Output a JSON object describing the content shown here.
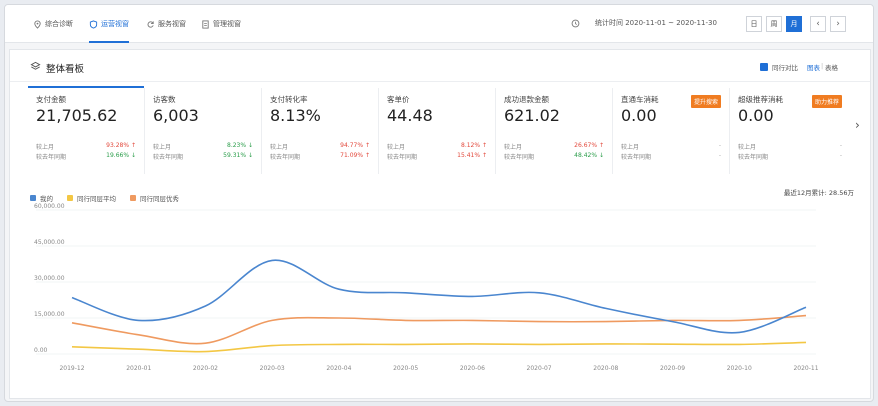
{
  "nav": {
    "tabs": [
      {
        "label": "综合诊断",
        "icon": "location-pin-icon"
      },
      {
        "label": "运营视窗",
        "icon": "shield-icon",
        "active": true
      },
      {
        "label": "服务视窗",
        "icon": "refresh-icon"
      },
      {
        "label": "管理视窗",
        "icon": "document-icon"
      }
    ],
    "date_range": "统计时间 2020-11-01 ~ 2020-11-30",
    "periods": [
      "日",
      "周",
      "月"
    ],
    "active_period": "月",
    "prev_label": "‹",
    "next_label": "›"
  },
  "panel": {
    "title": "整体看板",
    "compare_label": "同行对比",
    "view_chart": "图表",
    "view_sep": "|",
    "view_table": "表格",
    "next_arrow": "›"
  },
  "metrics": [
    {
      "name": "支付金额",
      "value": "21,705.62",
      "mom_label": "较上月",
      "mom": "93.28%",
      "mom_dir": "up",
      "yoy_label": "较去年同期",
      "yoy": "19.66%",
      "yoy_dir": "down"
    },
    {
      "name": "访客数",
      "value": "6,003",
      "mom_label": "较上月",
      "mom": "8.23%",
      "mom_dir": "down",
      "yoy_label": "较去年同期",
      "yoy": "59.31%",
      "yoy_dir": "down"
    },
    {
      "name": "支付转化率",
      "value": "8.13%",
      "mom_label": "较上月",
      "mom": "94.77%",
      "mom_dir": "up",
      "yoy_label": "较去年同期",
      "yoy": "71.09%",
      "yoy_dir": "up"
    },
    {
      "name": "客单价",
      "value": "44.48",
      "mom_label": "较上月",
      "mom": "8.12%",
      "mom_dir": "up",
      "yoy_label": "较去年同期",
      "yoy": "15.41%",
      "yoy_dir": "up"
    },
    {
      "name": "成功退款金额",
      "value": "621.02",
      "mom_label": "较上月",
      "mom": "26.67%",
      "mom_dir": "up",
      "yoy_label": "较去年同期",
      "yoy": "48.42%",
      "yoy_dir": "down"
    },
    {
      "name": "直通车消耗",
      "value": "0.00",
      "badge": "提升搜索",
      "mom_label": "较上月",
      "mom": "-",
      "mom_dir": "none",
      "yoy_label": "较去年同期",
      "yoy": "-",
      "yoy_dir": "none"
    },
    {
      "name": "超级推荐消耗",
      "value": "0.00",
      "badge": "助力推荐",
      "mom_label": "较上月",
      "mom": "-",
      "mom_dir": "none",
      "yoy_label": "较去年同期",
      "yoy": "-",
      "yoy_dir": "none"
    }
  ],
  "chart_summary": "最近12月累计: 28.56万",
  "colors": {
    "accent": "#1f6fd6",
    "mine": "#4a86cf",
    "peer_avg": "#f3c744",
    "peer_top": "#ef9a60",
    "badge": "#f07c21",
    "up": "#e2483b",
    "down": "#2a9d4a"
  },
  "chart_data": {
    "type": "line",
    "categories": [
      "2019-12",
      "2020-01",
      "2020-02",
      "2020-03",
      "2020-04",
      "2020-05",
      "2020-06",
      "2020-07",
      "2020-08",
      "2020-09",
      "2020-10",
      "2020-11"
    ],
    "ylim": [
      0,
      60000
    ],
    "yticks": [
      "0.00",
      "15,000.00",
      "30,000.00",
      "45,000.00",
      "60,000.00"
    ],
    "ytick_values": [
      0,
      15000,
      30000,
      45000,
      60000
    ],
    "series": [
      {
        "name": "我的",
        "color": "#4a86cf",
        "values": [
          23500,
          14000,
          20000,
          39000,
          27000,
          25500,
          24000,
          25500,
          19000,
          13500,
          9000,
          19500
        ]
      },
      {
        "name": "同行同层平均",
        "color": "#f3c744",
        "values": [
          3000,
          2000,
          1000,
          3500,
          4000,
          4000,
          4200,
          4000,
          4200,
          4100,
          4000,
          4800
        ]
      },
      {
        "name": "同行同层优秀",
        "color": "#ef9a60",
        "values": [
          13000,
          8000,
          4500,
          14000,
          15000,
          14000,
          14000,
          13500,
          13500,
          14000,
          14000,
          16000
        ]
      }
    ]
  }
}
